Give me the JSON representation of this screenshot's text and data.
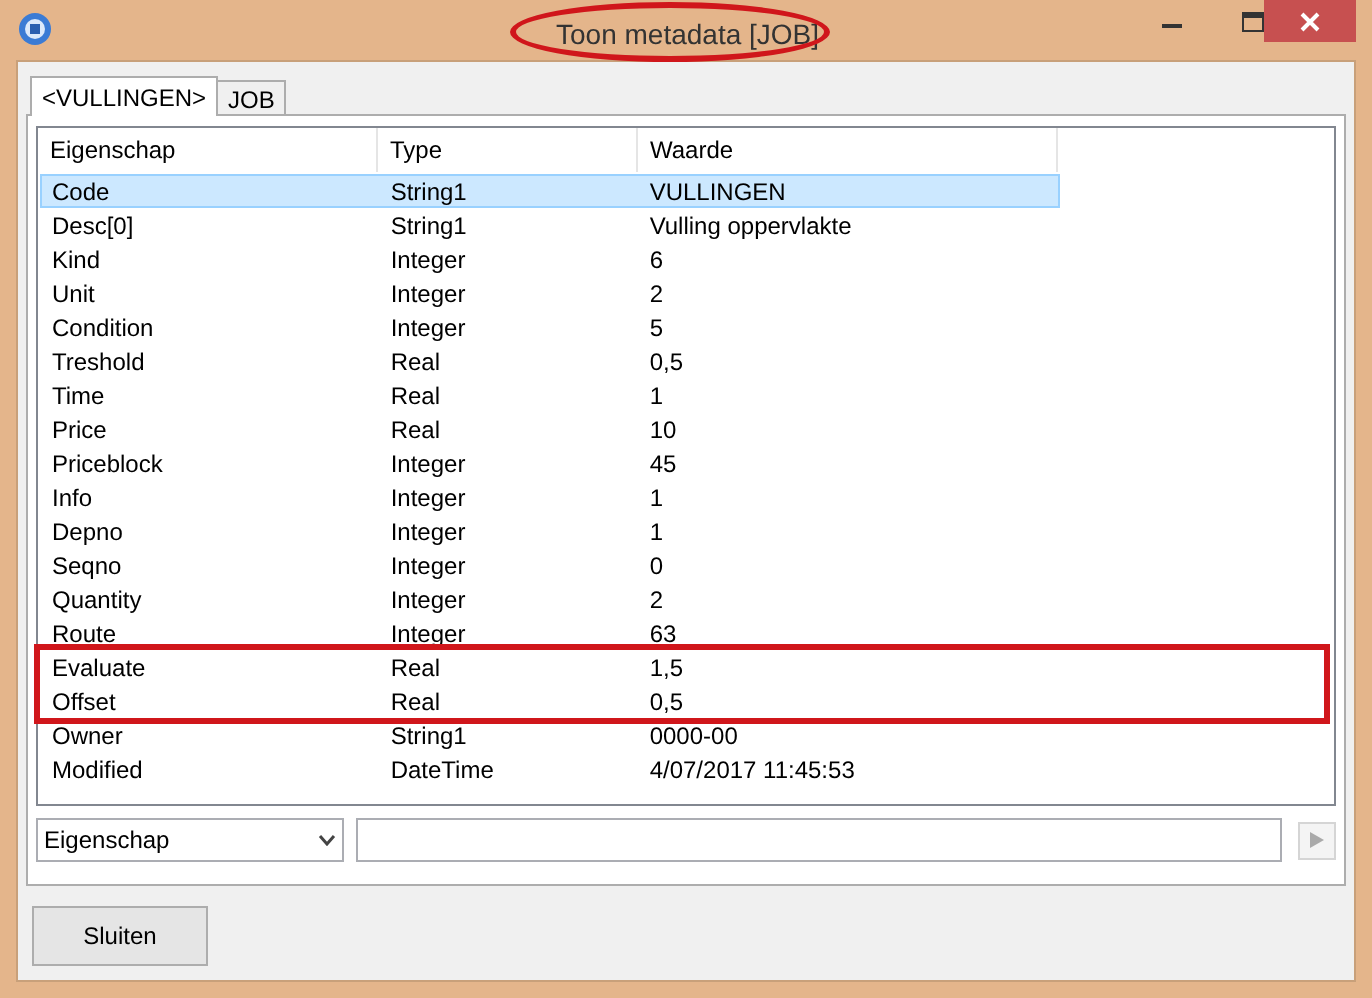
{
  "window": {
    "title": "Toon metadata [JOB]",
    "title_circled": true
  },
  "tabs": [
    {
      "label": "<VULLINGEN>",
      "selected": true
    },
    {
      "label": "JOB",
      "selected": false
    }
  ],
  "table": {
    "columns": [
      "Eigenschap",
      "Type",
      "Waarde"
    ],
    "rows": [
      {
        "cells": [
          "Code",
          "String1",
          "VULLINGEN"
        ],
        "selected": true,
        "highlighted": false
      },
      {
        "cells": [
          "Desc[0]",
          "String1",
          "Vulling oppervlakte"
        ],
        "selected": false,
        "highlighted": false
      },
      {
        "cells": [
          "Kind",
          "Integer",
          "6"
        ],
        "selected": false,
        "highlighted": false
      },
      {
        "cells": [
          "Unit",
          "Integer",
          "2"
        ],
        "selected": false,
        "highlighted": false
      },
      {
        "cells": [
          "Condition",
          "Integer",
          "5"
        ],
        "selected": false,
        "highlighted": false
      },
      {
        "cells": [
          "Treshold",
          "Real",
          "0,5"
        ],
        "selected": false,
        "highlighted": false
      },
      {
        "cells": [
          "Time",
          "Real",
          "1"
        ],
        "selected": false,
        "highlighted": false
      },
      {
        "cells": [
          "Price",
          "Real",
          "10"
        ],
        "selected": false,
        "highlighted": false
      },
      {
        "cells": [
          "Priceblock",
          "Integer",
          "45"
        ],
        "selected": false,
        "highlighted": false
      },
      {
        "cells": [
          "Info",
          "Integer",
          "1"
        ],
        "selected": false,
        "highlighted": false
      },
      {
        "cells": [
          "Depno",
          "Integer",
          "1"
        ],
        "selected": false,
        "highlighted": false
      },
      {
        "cells": [
          "Seqno",
          "Integer",
          "0"
        ],
        "selected": false,
        "highlighted": false
      },
      {
        "cells": [
          "Quantity",
          "Integer",
          "2"
        ],
        "selected": false,
        "highlighted": false
      },
      {
        "cells": [
          "Route",
          "Integer",
          "63"
        ],
        "selected": false,
        "highlighted": false
      },
      {
        "cells": [
          "Evaluate",
          "Real",
          "1,5"
        ],
        "selected": false,
        "highlighted": true
      },
      {
        "cells": [
          "Offset",
          "Real",
          "0,5"
        ],
        "selected": false,
        "highlighted": true
      },
      {
        "cells": [
          "Owner",
          "String1",
          "0000-00"
        ],
        "selected": false,
        "highlighted": false
      },
      {
        "cells": [
          "Modified",
          "DateTime",
          "4/07/2017 11:45:53"
        ],
        "selected": false,
        "highlighted": false
      }
    ]
  },
  "filter": {
    "field_select": "Eigenschap"
  },
  "buttons": [
    "Sluiten"
  ]
}
